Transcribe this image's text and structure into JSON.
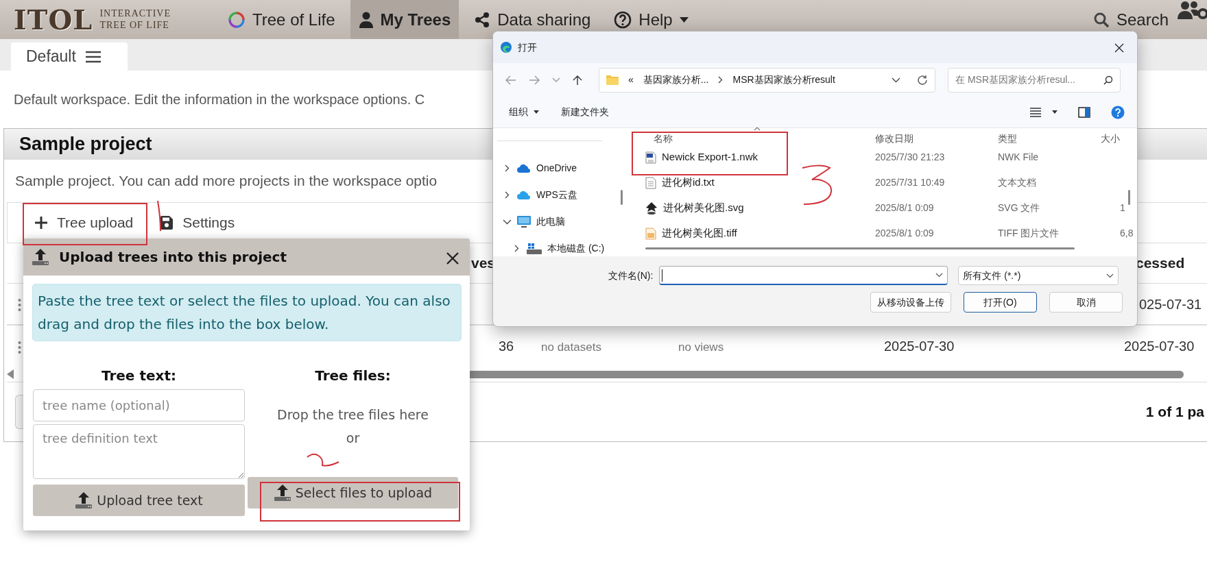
{
  "navbar": {
    "logo": "ITOL",
    "logo_tagline": [
      "INTERACTIVE",
      "TREE OF LIFE"
    ],
    "items": [
      {
        "label": "Tree of Life",
        "selected": false,
        "dropdown": false
      },
      {
        "label": "My Trees",
        "selected": true,
        "dropdown": false
      },
      {
        "label": "Data sharing",
        "selected": false,
        "dropdown": false
      },
      {
        "label": "Help",
        "selected": false,
        "dropdown": true
      }
    ],
    "search": "Search"
  },
  "workspace_tabs": [
    {
      "label": "Default",
      "selected": true
    }
  ],
  "workspace_description": "Default workspace. Edit the information in the workspace options. C",
  "project": {
    "title": "Sample project",
    "description": "Sample project. You can add more projects in the workspace optio",
    "toolbar": [
      "Tree upload",
      "Settings"
    ],
    "table": {
      "header": {
        "column_3": "ves",
        "column_7": "cessed"
      },
      "rows": [
        {
          "column_7": "025-07-31"
        },
        {
          "column_3": "36",
          "column_4": "no datasets",
          "column_5": "no views",
          "column_6": "2025-07-30",
          "column_7": "2025-07-30"
        }
      ]
    },
    "pagination": "1 of 1 pa"
  },
  "upload_popup": {
    "title": "Upload trees into this project",
    "info": "Paste the tree text or select the files to upload. You can also drag and drop the files into the box below.",
    "tree_text": {
      "heading": "Tree text:",
      "name_placeholder": "tree name (optional)",
      "definition_placeholder": "tree definition text",
      "button": "Upload tree text"
    },
    "tree_files": {
      "heading": "Tree files:",
      "drop_hint": "Drop the tree files here",
      "or": "or",
      "button": "Select files to upload"
    }
  },
  "file_dialog": {
    "title": "打开",
    "breadcrumb_overflow": "«",
    "breadcrumb": [
      "基因家族分析...",
      "MSR基因家族分析result"
    ],
    "search_placeholder": "在 MSR基因家族分析resul...",
    "organize": "组织",
    "new_folder": "新建文件夹",
    "nav_tree": [
      {
        "label": "OneDrive",
        "kind": "onedrive",
        "expanded": false
      },
      {
        "label": "WPS云盘",
        "kind": "cloud",
        "expanded": false
      },
      {
        "label": "此电脑",
        "kind": "computer",
        "expanded": true,
        "children": [
          {
            "label": "本地磁盘 (C:)",
            "kind": "drive",
            "expanded": false
          }
        ]
      }
    ],
    "columns": [
      "名称",
      "修改日期",
      "类型",
      "大小"
    ],
    "files": [
      {
        "name": "Newick Export-1.nwk",
        "kind": "nwk",
        "modified": "2025/7/30 21:23",
        "type": "NWK File"
      },
      {
        "name": "进化树id.txt",
        "kind": "text",
        "modified": "2025/7/31 10:49",
        "type": "文本文档"
      },
      {
        "name": "进化树美化图.svg",
        "kind": "svg",
        "modified": "2025/8/1 0:09",
        "type": "SVG 文件",
        "size": "1"
      },
      {
        "name": "进化树美化图.tiff",
        "kind": "image",
        "modified": "2025/8/1 0:09",
        "type": "TIFF 图片文件",
        "size": "6,8"
      }
    ],
    "filename_label": "文件名(N):",
    "filter": "所有文件 (*.*)",
    "buttons": [
      {
        "label": "从移动设备上传",
        "default": false
      },
      {
        "label": "打开(O)",
        "default": true
      },
      {
        "label": "取消",
        "default": false
      }
    ]
  }
}
